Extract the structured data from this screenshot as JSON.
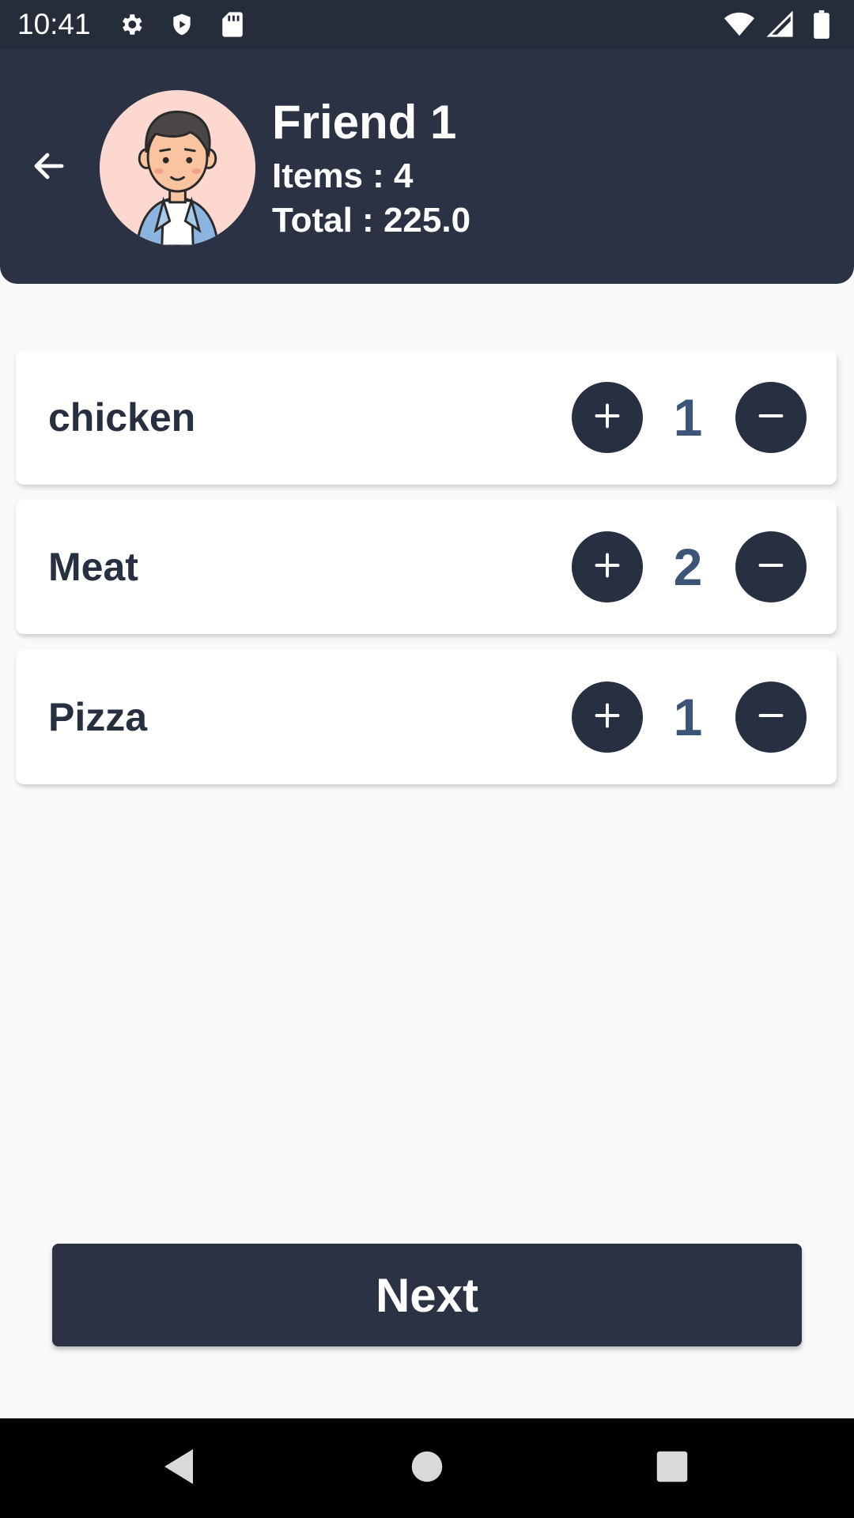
{
  "status_bar": {
    "time": "10:41",
    "icons_left": [
      "gear-icon",
      "shield-icon",
      "sd-card-icon"
    ],
    "icons_right": [
      "wifi-icon",
      "signal-icon",
      "battery-icon"
    ]
  },
  "header": {
    "back_icon": "arrow-left-icon",
    "avatar": "boy-avatar",
    "name": "Friend 1",
    "items_text": "Items : 4",
    "total_text": "Total : 225.0"
  },
  "items": [
    {
      "name": "chicken",
      "quantity": "1"
    },
    {
      "name": "Meat",
      "quantity": "2"
    },
    {
      "name": "Pizza",
      "quantity": "1"
    }
  ],
  "next_button": {
    "label": "Next"
  },
  "nav_bar": {
    "icons": [
      "back-triangle-icon",
      "home-circle-icon",
      "recents-square-icon"
    ]
  },
  "colors": {
    "header_bg": "#2a3243",
    "status_bg": "#252c3a",
    "button_dark": "#263040",
    "quantity_text": "#3c5478",
    "background": "#f9f9f9",
    "avatar_bg": "#fcd8d0"
  }
}
